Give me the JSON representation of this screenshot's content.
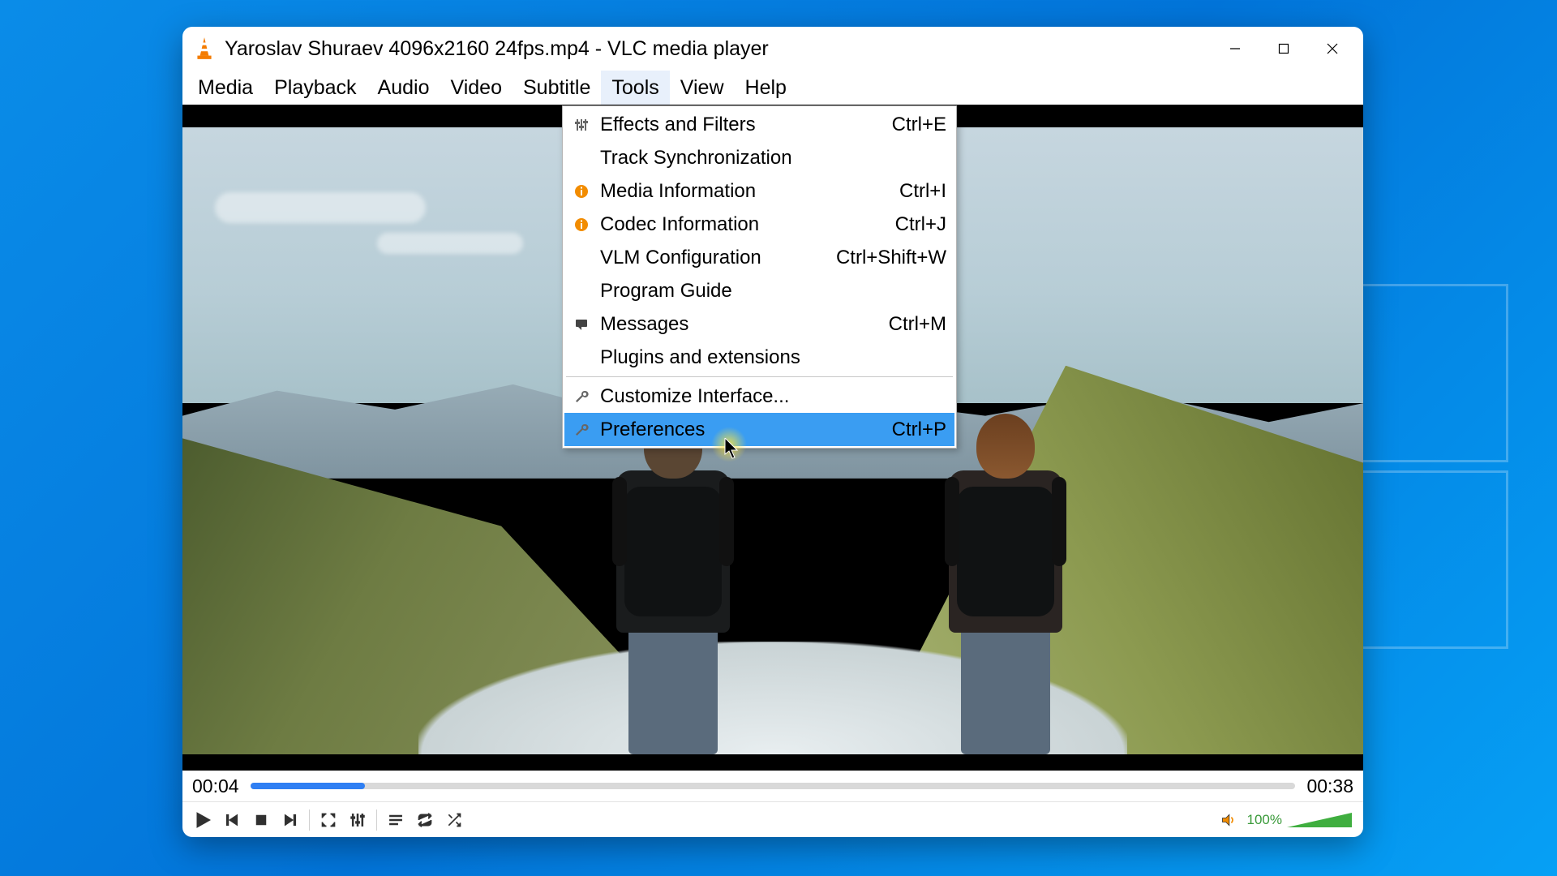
{
  "window": {
    "title": "Yaroslav Shuraev 4096x2160 24fps.mp4 - VLC media player"
  },
  "menubar": {
    "items": [
      {
        "label": "Media"
      },
      {
        "label": "Playback"
      },
      {
        "label": "Audio"
      },
      {
        "label": "Video"
      },
      {
        "label": "Subtitle"
      },
      {
        "label": "Tools"
      },
      {
        "label": "View"
      },
      {
        "label": "Help"
      }
    ]
  },
  "tools_menu": {
    "effects": {
      "label": "Effects and Filters",
      "shortcut": "Ctrl+E"
    },
    "sync": {
      "label": "Track Synchronization",
      "shortcut": ""
    },
    "mediainfo": {
      "label": "Media Information",
      "shortcut": "Ctrl+I"
    },
    "codecinfo": {
      "label": "Codec Information",
      "shortcut": "Ctrl+J"
    },
    "vlm": {
      "label": "VLM Configuration",
      "shortcut": "Ctrl+Shift+W"
    },
    "guide": {
      "label": "Program Guide",
      "shortcut": ""
    },
    "messages": {
      "label": "Messages",
      "shortcut": "Ctrl+M"
    },
    "plugins": {
      "label": "Plugins and extensions",
      "shortcut": ""
    },
    "custom": {
      "label": "Customize Interface...",
      "shortcut": ""
    },
    "prefs": {
      "label": "Preferences",
      "shortcut": "Ctrl+P"
    }
  },
  "player": {
    "elapsed": "00:04",
    "total": "00:38",
    "volume": "100%"
  }
}
